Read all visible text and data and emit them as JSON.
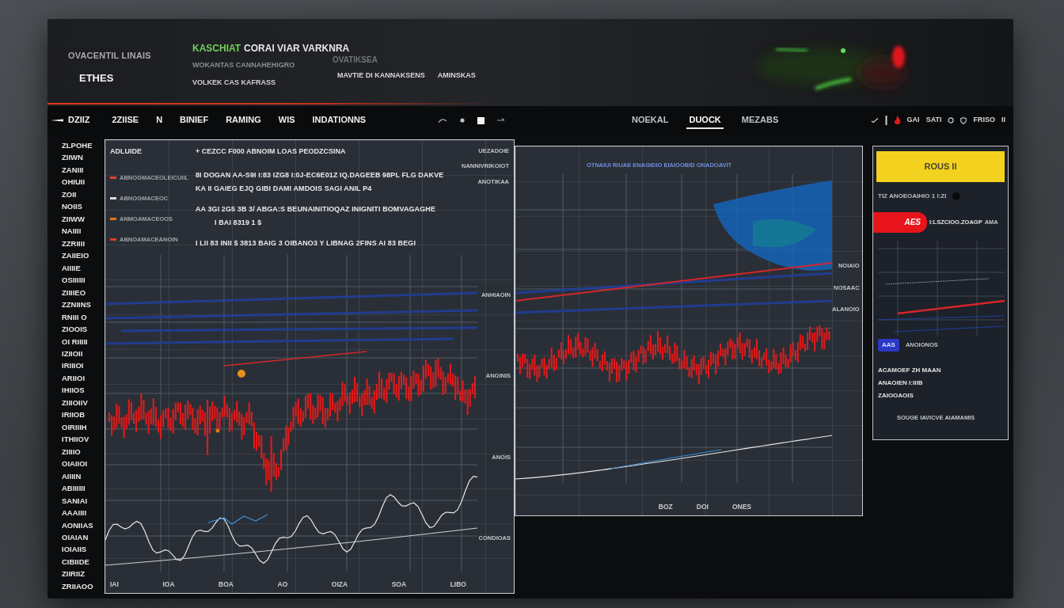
{
  "header": {
    "brand": {
      "caption": "OVACENTIL LINAIS",
      "name": "ETHES"
    },
    "title": {
      "highlight": "KASCHIAT",
      "rest": "CORAI VIAR VARKNRA",
      "line_1": "WOKANTAS CANNAHEHIGRO",
      "line_2": "VOLKEK CAS KAFRASS"
    },
    "status": {
      "label": "OVATIKSEA",
      "value": "MAVTIE DI KANNAKSENS",
      "extra": "AMINSKAS"
    }
  },
  "toolbar": {
    "title": "DZIIZ",
    "tabs": [
      {
        "label": "2ZIISE",
        "selected": false
      },
      {
        "label": "N",
        "selected": false
      },
      {
        "label": "BINIEF",
        "selected": false
      },
      {
        "label": "RAMING",
        "selected": false
      },
      {
        "label": "WIS",
        "selected": false
      },
      {
        "label": "INDATIONNS",
        "selected": false
      }
    ],
    "view_tabs": [
      {
        "label": "NOEKAL",
        "selected": false
      },
      {
        "label": "DUOCK",
        "selected": true
      },
      {
        "label": "MEZABS",
        "selected": false
      }
    ],
    "right_labels": [
      "GAI",
      "SATI",
      "FRISO",
      "II"
    ]
  },
  "axis_labels": [
    "ZLPOHE",
    "ZIIWN",
    "ZANIII",
    "OHIUII",
    "ZOII",
    "NOIIS",
    "ZIIWW",
    "NAIIII",
    "ZZRIIII",
    "ZAIIEIO",
    "AIIIIE",
    "OSIIIIII",
    "ZIIIIEO",
    "ZZNIINS",
    "RNIII O",
    "ZIOOIS",
    "OI RIIIII",
    "IZIIOII",
    "IRIIIOI",
    "ARIIOI",
    "IHIIOS",
    "ZIIIOIIV",
    "IRIIOB",
    "OIRIIIH",
    "ITHIIOV",
    "ZIIIIO",
    "OIAIIOI",
    "AIIIIN",
    "ABIIIIII",
    "SANIAI",
    "AAAIIII",
    "AONIIAS",
    "OIAIAN",
    "IOIAIIS",
    "CIBIIDE",
    "ZIIRIIZ",
    "ZRIIAOO"
  ],
  "chart_panel": {
    "title": "ADLUIDE",
    "headline": "+ CEZCC F000 ABNOIM LOAS PEODZCSINA",
    "corner": "UEZADOIE",
    "legend": [
      {
        "label": "ABNOGMACEOLEICUIIL",
        "color": "#e0442c"
      },
      {
        "label": "ABNOGMACEOC",
        "color": "#d8d8d8"
      },
      {
        "label": "ANMOAMACEOOS",
        "color": "#e8741c"
      },
      {
        "label": "ABNOAMACEANOIN",
        "color": "#e23a2a"
      }
    ],
    "lines": [
      "8I DOGAN AA-S9I I:83 IZG8 I:0J-EC6E01Z IQ.DAGEEB 98PL FLG DAKVE",
      "KA II GAIEG EJQ GIBI DAMI AMDOIS SAGI ANIL P4",
      "AA 3GI 2G5 3B 3/ ABGA:S BEUNAINITIOQAZ INIGNITI BOMVAGAGHE",
      "I BAI 8319 1 $",
      "I LII 83 INII $ 3813 BAIG 3   OIBANO3 Y LIBNAG 2FINS AI 83 BEGI"
    ],
    "side_notes": [
      "NANNIVRIKOIOT",
      "ANOTIKAA"
    ],
    "chart_notes": [
      "ANHIAOIN",
      "ANOINIS",
      "ANOIS",
      "CONDIOAS"
    ],
    "x_labels": [
      "IAI",
      "IOA",
      "BOA",
      "AO",
      "OIZA",
      "SOA",
      "LIBO"
    ]
  },
  "detail_panel": {
    "caption": "OTNAIUI RIUAE ENAGIDIO EIAIOOBID ONADOAVIT",
    "side_notes": [
      "NOIAIO",
      "NOSAAC",
      "ALANOIO"
    ],
    "x_labels": [
      "BOZ",
      "DOI",
      "ONES"
    ]
  },
  "side_panel": {
    "header": "ROUS II",
    "row": "TIZ ANOEOAIHIO 1 I:ZI",
    "alert": {
      "badge": "AES",
      "text": "I:LSZCIOO.ZOAGP",
      "extra": "AMA"
    },
    "note": "ANOIONOS",
    "tag": "AAS",
    "notes": [
      "ACAMOEF ZH MAAN",
      "ANAOIEN I:IIIB",
      "ZAIOOAOIS"
    ],
    "footer": "SOUGE IAVICVE AIAMAMIS"
  }
}
